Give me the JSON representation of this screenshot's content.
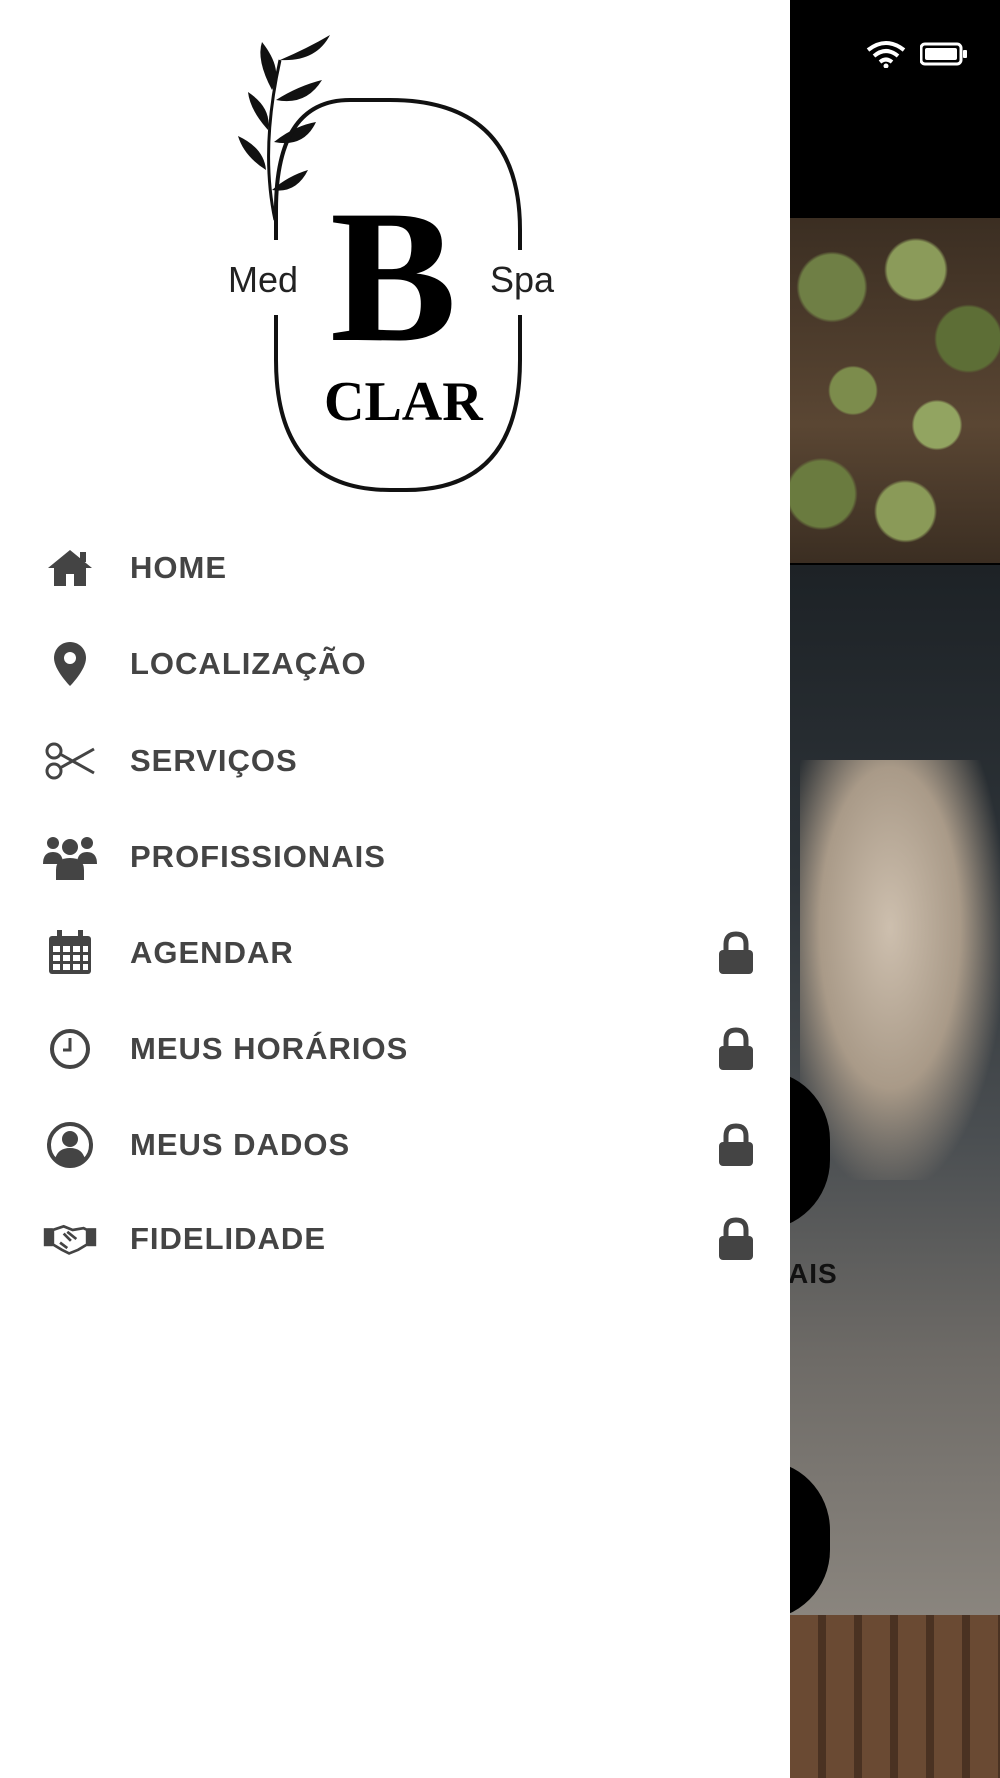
{
  "logo": {
    "left_text": "Med",
    "right_text": "Spa",
    "monogram": "B",
    "name": "CLAR"
  },
  "menu": {
    "items": [
      {
        "label": "HOME",
        "icon": "home-icon",
        "locked": false
      },
      {
        "label": "LOCALIZAÇÃO",
        "icon": "location-pin-icon",
        "locked": false
      },
      {
        "label": "SERVIÇOS",
        "icon": "scissors-icon",
        "locked": false
      },
      {
        "label": "PROFISSIONAIS",
        "icon": "users-group-icon",
        "locked": false
      },
      {
        "label": "AGENDAR",
        "icon": "calendar-icon",
        "locked": true
      },
      {
        "label": "MEUS HORÁRIOS",
        "icon": "clock-icon",
        "locked": true
      },
      {
        "label": "MEUS DADOS",
        "icon": "user-circle-icon",
        "locked": true
      },
      {
        "label": "FIDELIDADE",
        "icon": "handshake-icon",
        "locked": true
      }
    ]
  },
  "background_app": {
    "partial_label": "AIS"
  },
  "colors": {
    "menu_text": "#444444",
    "drawer_bg": "#ffffff",
    "app_header": "#000000"
  }
}
